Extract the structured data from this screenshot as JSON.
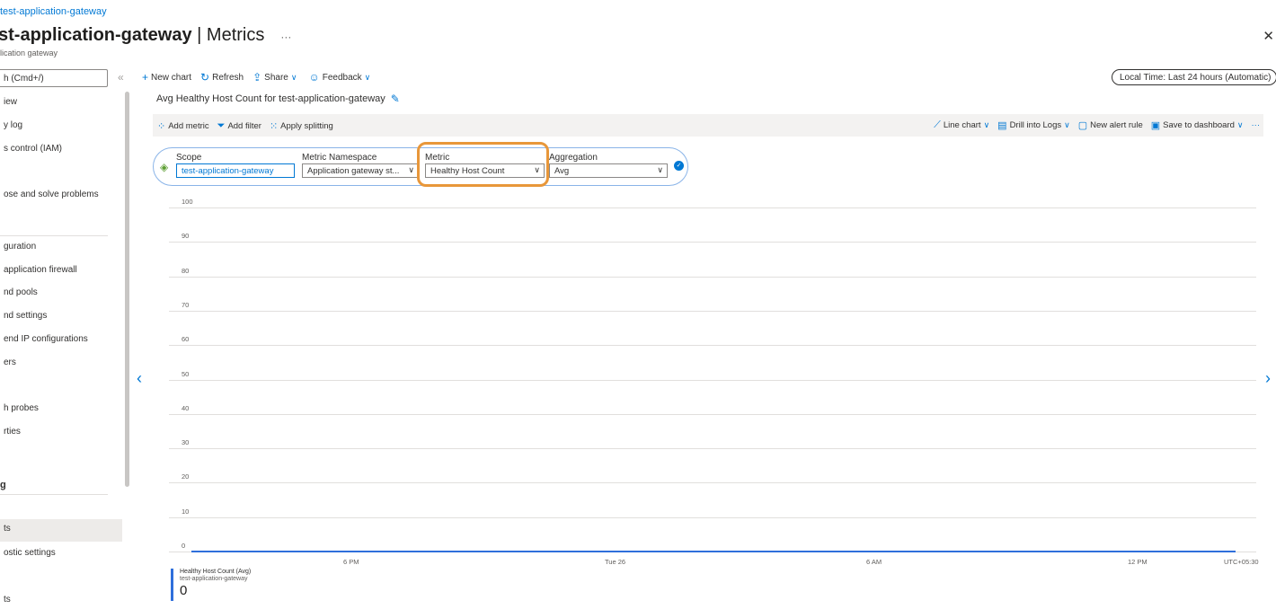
{
  "header": {
    "breadcrumb": "test-application-gateway",
    "title_resource": "st-application-gateway",
    "title_separator": " | ",
    "title_blade": "Metrics",
    "more": "···",
    "subtitle": "lication gateway",
    "close": "✕"
  },
  "sidebar": {
    "search_placeholder": "h (Cmd+/)",
    "collapse": "«",
    "items": [
      {
        "label": "iew"
      },
      {
        "label": "y log"
      },
      {
        "label": "s control (IAM)"
      },
      {
        "label": ""
      },
      {
        "label": "ose and solve problems"
      },
      {
        "label": "guration"
      },
      {
        "label": "application firewall"
      },
      {
        "label": "nd pools"
      },
      {
        "label": "nd settings"
      },
      {
        "label": "end IP configurations"
      },
      {
        "label": "ers"
      },
      {
        "label": "h probes"
      },
      {
        "label": "rties"
      },
      {
        "label": "ts"
      },
      {
        "label": "ostic settings"
      },
      {
        "label": "ts"
      }
    ],
    "section_monitoring": "g"
  },
  "toolbar": {
    "new_chart": "New chart",
    "refresh": "Refresh",
    "share": "Share",
    "feedback": "Feedback",
    "time_range": "Local Time: Last 24 hours (Automatic)"
  },
  "chart": {
    "title": "Avg Healthy Host Count for test-application-gateway",
    "add_metric": "Add metric",
    "add_filter": "Add filter",
    "apply_splitting": "Apply splitting",
    "line_chart": "Line chart",
    "drill_logs": "Drill into Logs",
    "new_alert": "New alert rule",
    "save_dashboard": "Save to dashboard",
    "more": "···",
    "scope_label": "Scope",
    "scope_value": "test-application-gateway",
    "namespace_label": "Metric Namespace",
    "namespace_value": "Application gateway st...",
    "metric_label": "Metric",
    "metric_value": "Healthy Host Count",
    "aggregation_label": "Aggregation",
    "aggregation_value": "Avg",
    "timezone": "UTC+05:30",
    "legend_name": "Healthy Host Count (Avg)",
    "legend_resource": "test-application-gateway",
    "legend_value": "0"
  },
  "chart_data": {
    "type": "line",
    "y_ticks": [
      "100",
      "90",
      "80",
      "70",
      "60",
      "50",
      "40",
      "30",
      "20",
      "10",
      "0"
    ],
    "x_ticks": [
      "6 PM",
      "Tue 26",
      "6 AM",
      "12 PM"
    ],
    "ylim": [
      0,
      100
    ],
    "series": [
      {
        "name": "Healthy Host Count (Avg)",
        "values": [
          0,
          0,
          0,
          0,
          0
        ]
      }
    ],
    "colors": {
      "series": "#2f6fdb",
      "accent": "#0078d4",
      "highlight": "#e8973a"
    }
  }
}
